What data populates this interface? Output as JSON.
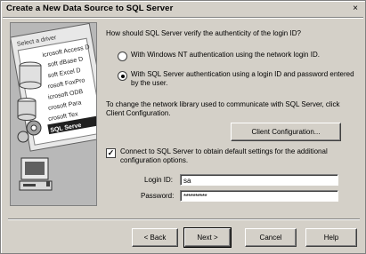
{
  "window": {
    "title": "Create a New Data Source to SQL Server",
    "close_glyph": "×"
  },
  "art": {
    "label": "Select a driver",
    "drivers": [
      "icrosoft Access D",
      "soft dBase D",
      "soft Excel D",
      "rosoft FoxPro",
      "icrosoft ODB",
      "crosoft Para",
      "crosoft Tex",
      "SQL Serve"
    ]
  },
  "auth": {
    "question": "How should SQL Server verify the authenticity of the login ID?",
    "option_nt": "With Windows NT authentication using the network login ID.",
    "option_sql": "With SQL Server authentication using a login ID and password entered by the user.",
    "selected": "sql"
  },
  "netlib": {
    "text": "To change the network library used to communicate with SQL Server, click Client Configuration.",
    "button_label": "Client Configuration..."
  },
  "connect": {
    "label": "Connect to SQL Server to obtain default settings for the additional configuration options.",
    "checked": true
  },
  "login": {
    "login_id_label": "Login ID:",
    "login_id_value": "sa",
    "password_label": "Password:",
    "password_value": "**********"
  },
  "buttons": {
    "back": "< Back",
    "next": "Next >",
    "cancel": "Cancel",
    "help": "Help"
  }
}
